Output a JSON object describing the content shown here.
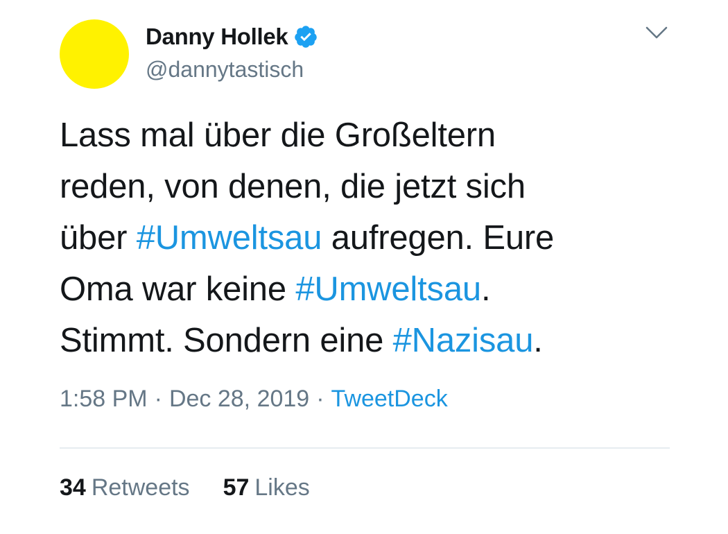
{
  "colors": {
    "avatar": "#fff200",
    "link": "#1b95e0",
    "text": "#14171a",
    "secondary": "#657786",
    "divider": "#e6ecf0",
    "verified": "#1da1f2"
  },
  "author": {
    "display_name": "Danny Hollek",
    "handle": "@dannytastisch",
    "verified": true,
    "verified_icon": "verified-badge-icon",
    "avatar_icon": "yellow-circle-avatar"
  },
  "menu": {
    "icon": "chevron-down-icon"
  },
  "tweet": {
    "segments": [
      {
        "text": "Lass mal über die Großeltern\nreden, von denen, die jetzt sich\nüber ",
        "hashtag": false
      },
      {
        "text": "#Umweltsau",
        "hashtag": true
      },
      {
        "text": " aufregen. Eure\nOma war keine ",
        "hashtag": false
      },
      {
        "text": "#Umweltsau",
        "hashtag": true
      },
      {
        "text": ".\nStimmt. Sondern eine ",
        "hashtag": false
      },
      {
        "text": "#Nazisau",
        "hashtag": true
      },
      {
        "text": ".",
        "hashtag": false
      }
    ]
  },
  "meta": {
    "time": "1:58 PM",
    "separator": "·",
    "date": "Dec 28, 2019",
    "source": "TweetDeck"
  },
  "stats": {
    "retweets_count": "34",
    "retweets_label": "Retweets",
    "likes_count": "57",
    "likes_label": "Likes"
  }
}
